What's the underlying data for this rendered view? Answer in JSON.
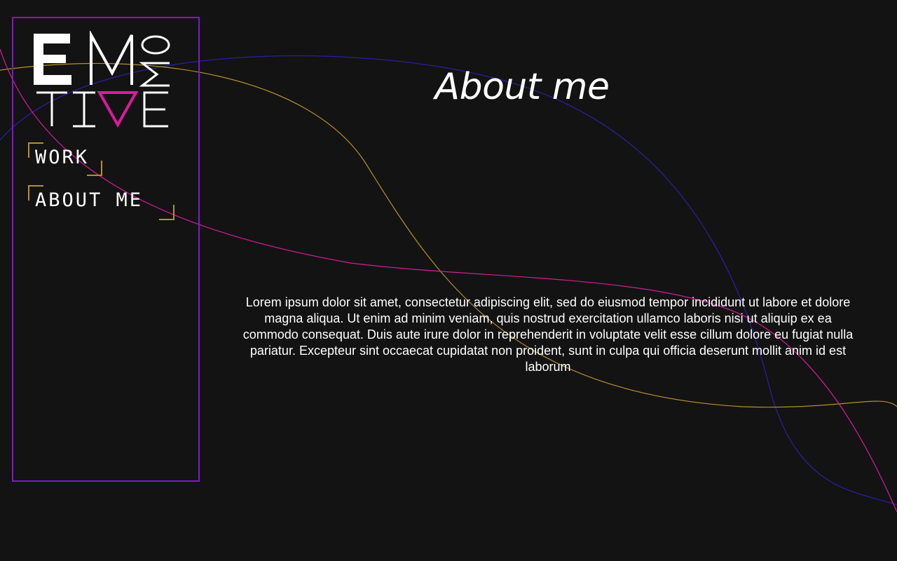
{
  "logo": {
    "letters": [
      "E",
      "M",
      "O",
      "M",
      "T",
      "I",
      "V",
      "E"
    ],
    "accent_color": "#d81b9c",
    "alt": "EMOTIVE"
  },
  "nav": {
    "items": [
      {
        "label": "WORK"
      },
      {
        "label": "ABOUT ME"
      }
    ]
  },
  "main": {
    "title": "About me",
    "body": "Lorem ipsum dolor sit amet, consectetur adipiscing elit, sed do eiusmod tempor incididunt ut labore et dolore magna aliqua. Ut enim ad minim veniam, quis nostrud exercitation ullamco laboris nisi ut aliquip ex ea commodo consequat. Duis aute irure dolor in reprehenderit in voluptate velit esse cillum dolore eu fugiat nulla pariatur. Excepteur sint occaecat cupidatat non proident, sunt in culpa qui officia deserunt mollit anim id est laborum"
  },
  "colors": {
    "background": "#131313",
    "sidebar_border": "#7f19c8",
    "nav_corner": "#b68f2c",
    "curve_gold": "#b68f2c",
    "curve_magenta": "#d81b9c",
    "curve_blue": "#2a1f9e"
  }
}
